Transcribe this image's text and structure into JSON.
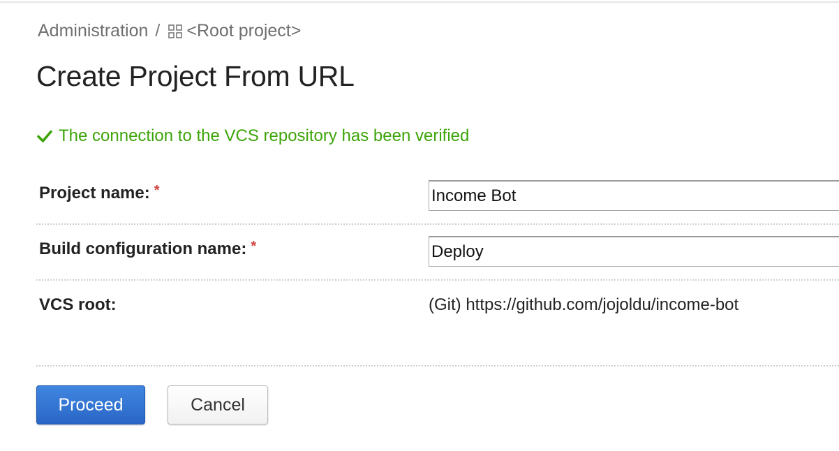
{
  "breadcrumb": {
    "admin_label": "Administration",
    "separator": "/",
    "project_icon": "project-grid-icon",
    "project_label": "<Root project>"
  },
  "page": {
    "title": "Create Project From URL"
  },
  "status": {
    "icon": "check-icon",
    "message": "The connection to the VCS repository has been verified",
    "color": "#3da40a"
  },
  "form": {
    "project_name": {
      "label": "Project name:",
      "required_mark": "*",
      "value": "Income Bot"
    },
    "build_config_name": {
      "label": "Build configuration name:",
      "required_mark": "*",
      "value": "Deploy"
    },
    "vcs_root": {
      "label": "VCS root:",
      "value": "(Git) https://github.com/jojoldu/income-bot"
    }
  },
  "actions": {
    "proceed_label": "Proceed",
    "cancel_label": "Cancel",
    "primary_color": "#2f72d6"
  }
}
